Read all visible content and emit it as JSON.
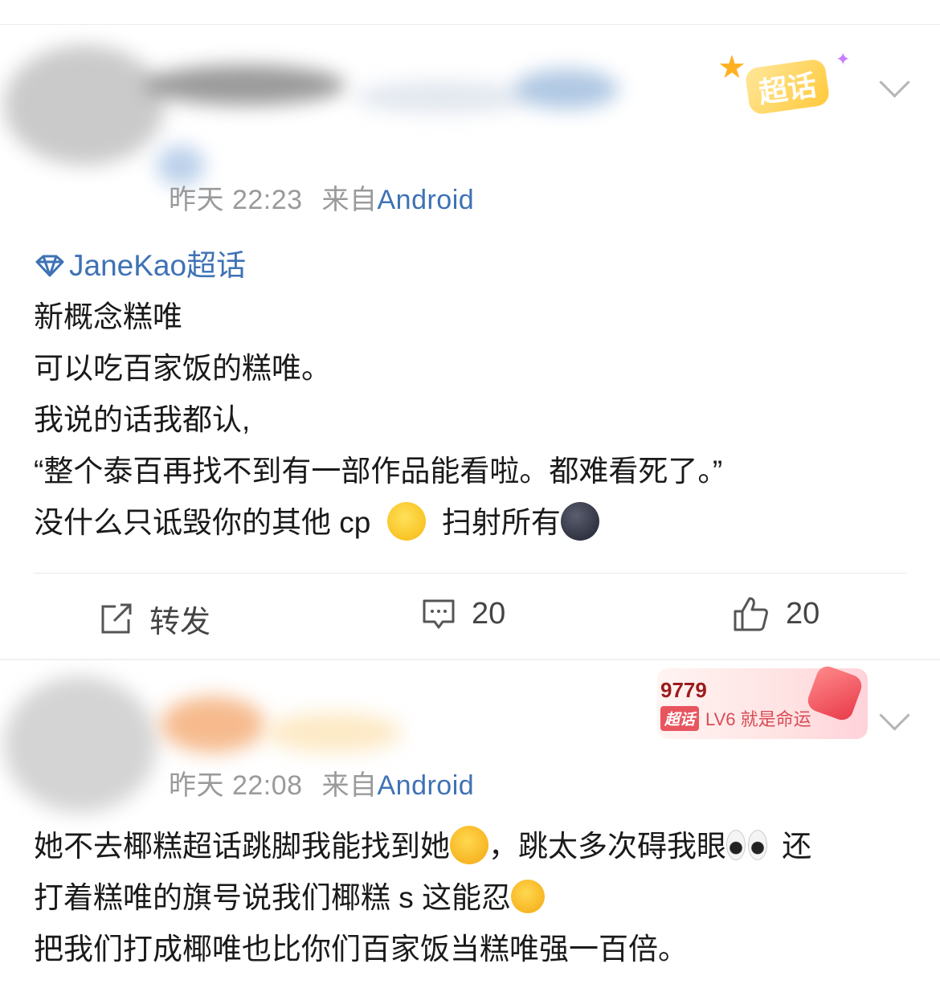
{
  "posts": [
    {
      "timestamp": "昨天 22:23",
      "source_prefix": "来自",
      "source": "Android",
      "badge_label": "超话",
      "topic_tag": "JaneKao超话",
      "lines": [
        "新概念糕唯",
        "可以吃百家饭的糕唯。",
        "我说的话我都认,",
        "“整个泰百再找不到有一部作品能看啦。都难看死了。”",
        "没什么只诋毁你的其他 cp",
        "扫射所有"
      ],
      "emojis": [
        "wink-emoji",
        "new-moon-face-emoji"
      ],
      "actions": {
        "repost_label": "转发",
        "comment_count": "20",
        "like_count": "20"
      }
    },
    {
      "timestamp": "昨天 22:08",
      "source_prefix": "来自",
      "source": "Android",
      "fan_number": "9779",
      "level_tag": "超话",
      "level_text": "LV6 就是命运",
      "lines": [
        "她不去椰糕超话跳脚我能找到她",
        "，跳太多次碍我眼",
        "还",
        "打着糕唯的旗号说我们椰糕 s 这能忍",
        "把我们打成椰唯也比你们百家饭当糕唯强一百倍。"
      ],
      "emojis": [
        "hugging-face-emoji",
        "eyes-emoji",
        "thinking-face-emoji"
      ]
    }
  ],
  "colors": {
    "link_blue": "#3f72b5",
    "meta_gray": "#9a9a9a",
    "badge_gold": "#ffc93a",
    "level_red": "#e8555f"
  }
}
